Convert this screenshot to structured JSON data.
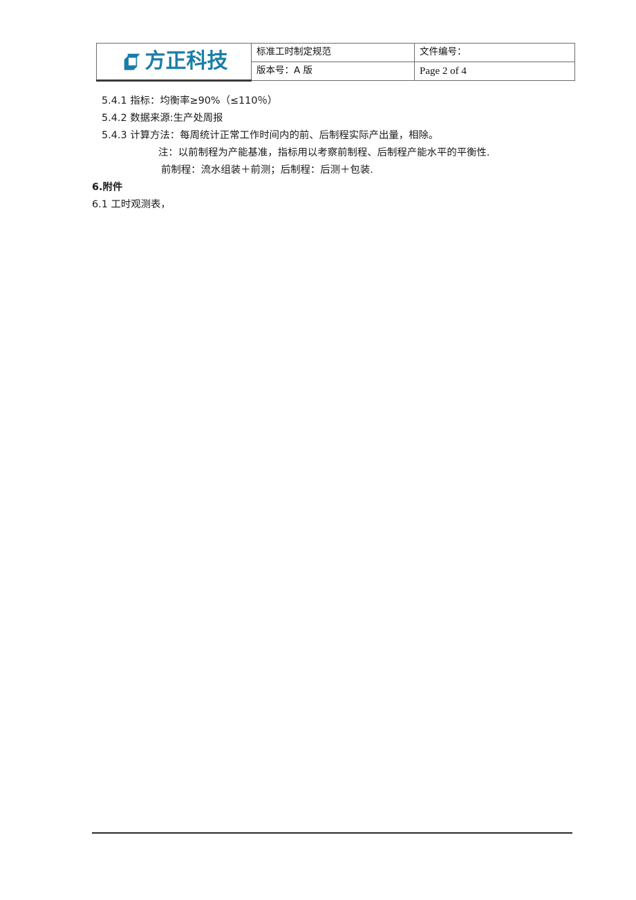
{
  "colors": {
    "logo": "#1b7da6",
    "text": "#1a1a1a",
    "rule": "#2b2b2b",
    "table_border": "#6b6b6b",
    "logo_cell_bottom": "#3a3a3a"
  },
  "header": {
    "logo_text": "方正科技",
    "logo_icon": "hexagon-ring-icon",
    "doc_title": "标准工时制定规范",
    "doc_number_label": "文件编号：",
    "version": "版本号：A 版",
    "page_indicator": "Page 2 of 4"
  },
  "body": {
    "lines": [
      {
        "id": "5.4.1",
        "text": "5.4.1 指标：均衡率≥90%（≤110％）",
        "indent": "ind-1",
        "bold": false
      },
      {
        "id": "5.4.2",
        "text": "5.4.2 数据来源:生产处周报",
        "indent": "ind-1",
        "bold": false
      },
      {
        "id": "5.4.3",
        "text": "5.4.3 计算方法：每周统计正常工作时间内的前、后制程实际产出量，相除。",
        "indent": "ind-1",
        "bold": false
      },
      {
        "id": "note-1",
        "text": "注：以前制程为产能基准，指标用以考察前制程、后制程产能水平的平衡性.",
        "indent": "ind-2",
        "bold": false
      },
      {
        "id": "note-2",
        "text": "前制程：流水组装＋前测；后制程：后测＋包装.",
        "indent": "ind-3",
        "bold": false
      },
      {
        "id": "6",
        "text": "6.附件",
        "indent": "ind-0",
        "bold": true
      },
      {
        "id": "6.1",
        "text": "6.1 工时观测表，",
        "indent": "ind-0",
        "bold": false
      }
    ]
  }
}
